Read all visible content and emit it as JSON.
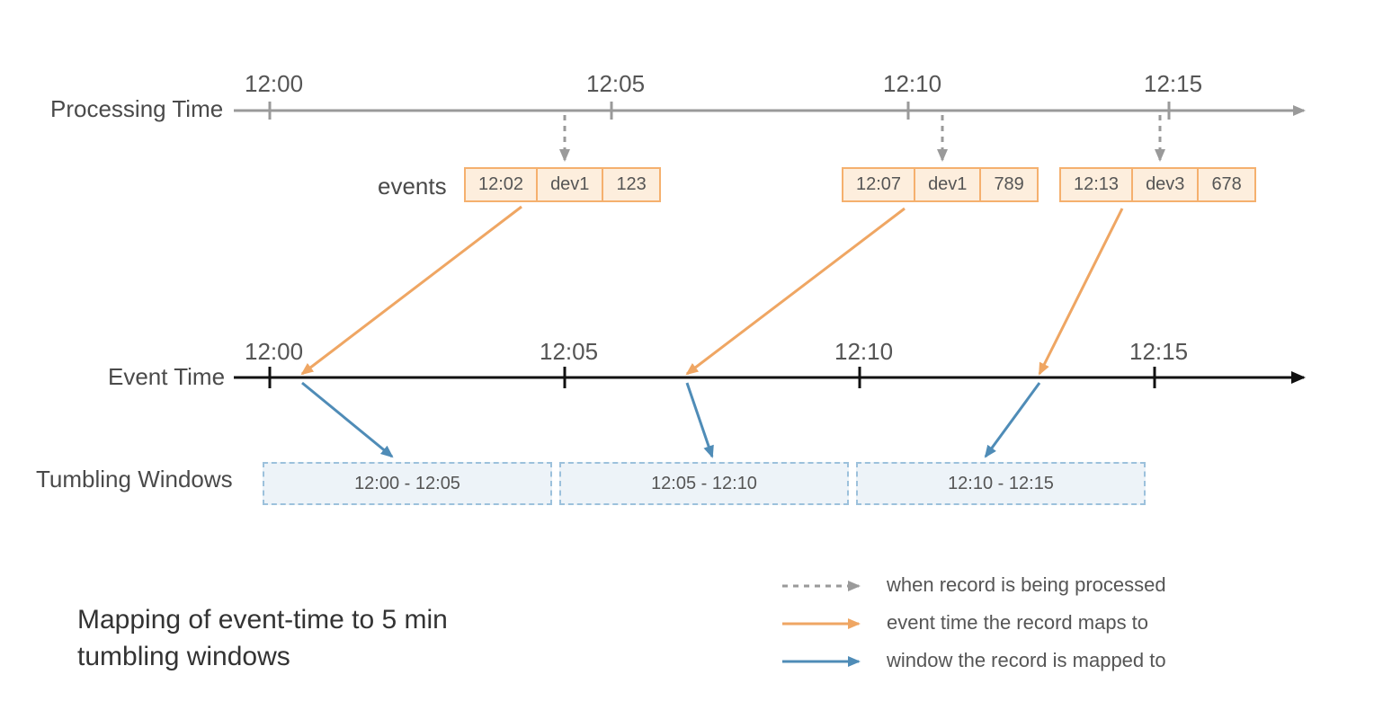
{
  "labels": {
    "processing_time": "Processing Time",
    "event_time": "Event Time",
    "tumbling_windows": "Tumbling Windows",
    "events": "events"
  },
  "processing_axis": {
    "ticks": [
      "12:00",
      "12:05",
      "12:10",
      "12:15"
    ]
  },
  "event_axis": {
    "ticks": [
      "12:00",
      "12:05",
      "12:10",
      "12:15"
    ]
  },
  "events": [
    {
      "time": "12:02",
      "device": "dev1",
      "value": "123"
    },
    {
      "time": "12:07",
      "device": "dev1",
      "value": "789"
    },
    {
      "time": "12:13",
      "device": "dev3",
      "value": "678"
    }
  ],
  "windows": [
    {
      "range": "12:00 - 12:05"
    },
    {
      "range": "12:05 - 12:10"
    },
    {
      "range": "12:10 - 12:15"
    }
  ],
  "legend": {
    "processed": "when record is being processed",
    "event_time": "event time the record maps to",
    "window": "window the record is mapped to"
  },
  "title_line1": "Mapping of event-time to 5 min",
  "title_line2": "tumbling windows",
  "colors": {
    "gray": "#9a9a9a",
    "orange": "#efa663",
    "blue": "#4f8cb7",
    "black": "#111"
  }
}
